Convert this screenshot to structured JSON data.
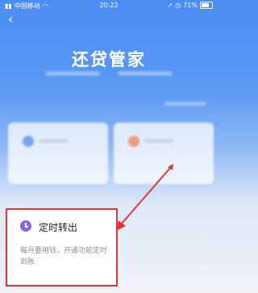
{
  "status": {
    "carrier": "中国移动",
    "time": "20:22",
    "battery": "71%"
  },
  "header": {
    "back_icon": "‹",
    "title": "还贷管家"
  },
  "popup": {
    "title": "定时转出",
    "description": "每月要用钱，开通功能定时到账"
  },
  "colors": {
    "annotation": "#e0353d",
    "accent": "#8b63e6"
  }
}
